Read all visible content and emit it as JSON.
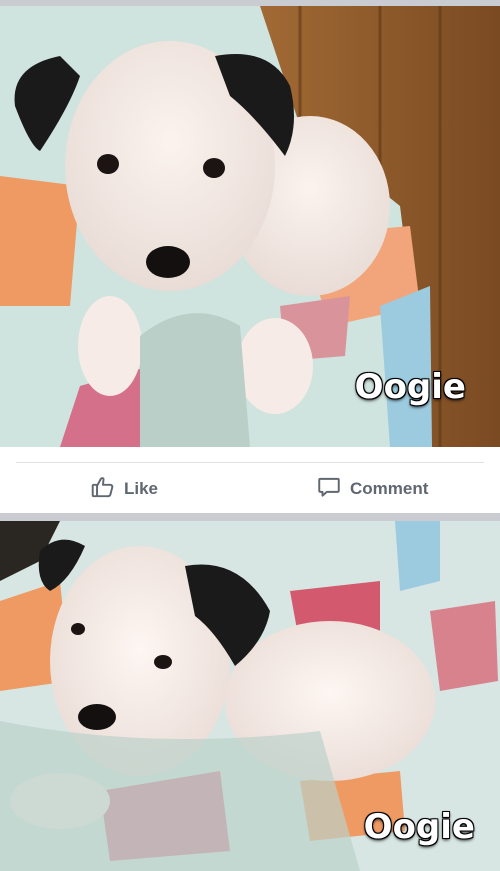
{
  "photos": [
    {
      "caption": "Oogie"
    },
    {
      "caption": "Oogie"
    }
  ],
  "actions": {
    "like_label": "Like",
    "comment_label": "Comment"
  },
  "icons": {
    "like": "thumbs-up-icon",
    "comment": "comment-bubble-icon"
  },
  "colors": {
    "action_text": "#606770",
    "separator": "#c9ccd1"
  }
}
